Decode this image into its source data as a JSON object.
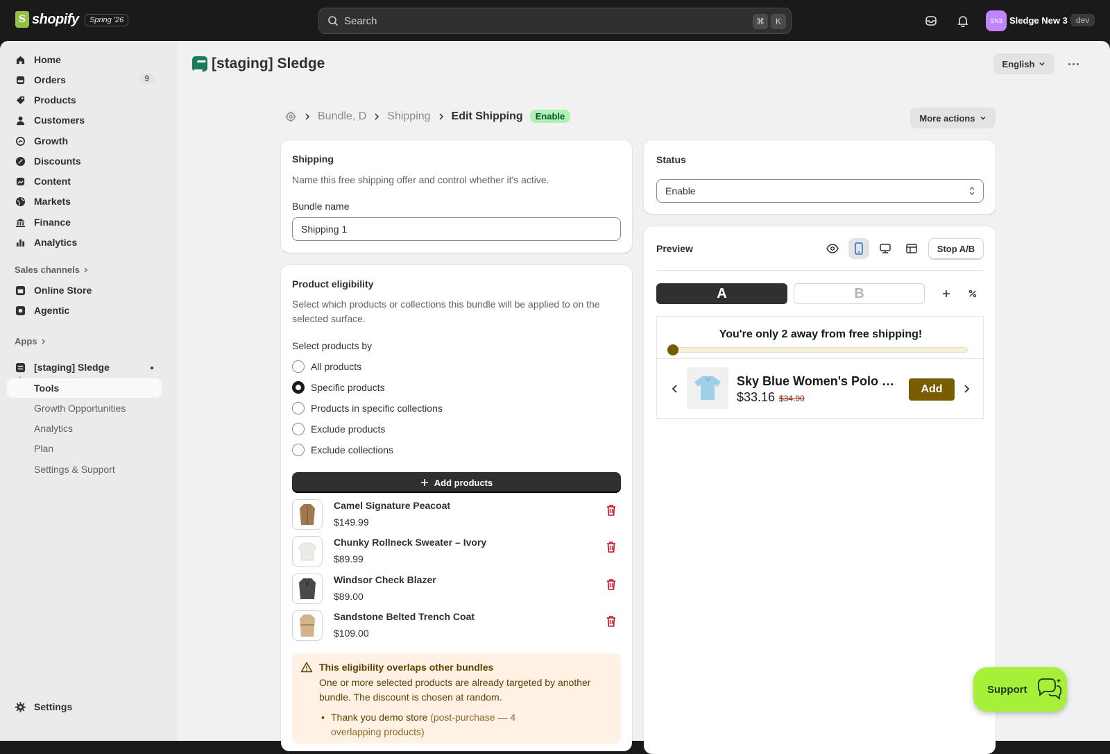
{
  "topbar": {
    "brand": "shopify",
    "edition_badge": "Spring '26",
    "search_placeholder": "Search",
    "shortcut_cmd": "⌘",
    "shortcut_key": "K",
    "avatar_initials": "SN3",
    "store_name": "Sledge New 3",
    "env_badge": "dev"
  },
  "sidebar": {
    "items": [
      {
        "label": "Home",
        "icon": "home-icon"
      },
      {
        "label": "Orders",
        "icon": "orders-icon",
        "count": "9"
      },
      {
        "label": "Products",
        "icon": "tag-icon"
      },
      {
        "label": "Customers",
        "icon": "person-icon"
      },
      {
        "label": "Growth",
        "icon": "growth-icon"
      },
      {
        "label": "Discounts",
        "icon": "discount-icon"
      },
      {
        "label": "Content",
        "icon": "content-icon"
      },
      {
        "label": "Markets",
        "icon": "globe-icon"
      },
      {
        "label": "Finance",
        "icon": "bank-icon"
      },
      {
        "label": "Analytics",
        "icon": "bar-chart-icon"
      }
    ],
    "sales_channels_label": "Sales channels",
    "channels": [
      {
        "label": "Online Store",
        "icon": "store-icon"
      },
      {
        "label": "Agentic",
        "icon": "agentic-icon"
      }
    ],
    "apps_label": "Apps",
    "app": {
      "label": "[staging] Sledge",
      "sub_items": [
        "Tools",
        "Growth Opportunities",
        "Analytics",
        "Plan",
        "Settings & Support"
      ]
    },
    "settings_label": "Settings"
  },
  "header": {
    "app_title": "[staging] Sledge",
    "language": "English"
  },
  "breadcrumbs": {
    "items": [
      "Bundle, D",
      "Shipping"
    ],
    "current": "Edit Shipping",
    "status_badge": "Enable",
    "more_actions": "More actions"
  },
  "shipping_card": {
    "title": "Shipping",
    "description": "Name this free shipping offer and control whether it's active.",
    "name_label": "Bundle name",
    "name_value": "Shipping 1"
  },
  "eligibility_card": {
    "title": "Product eligibility",
    "description": "Select which products or collections this bundle will be applied to on the selected surface.",
    "select_label": "Select products by",
    "options": [
      "All products",
      "Specific products",
      "Products in specific collections",
      "Exclude products",
      "Exclude collections"
    ],
    "selected_option": "Specific products",
    "add_button": "Add products",
    "products": [
      {
        "name": "Camel Signature Peacoat",
        "price": "$149.99",
        "thumb_color": "#a07a4e"
      },
      {
        "name": "Chunky Rollneck Sweater – Ivory",
        "price": "$89.99",
        "thumb_color": "#ecebe6"
      },
      {
        "name": "Windsor Check Blazer",
        "price": "$89.00",
        "thumb_color": "#4a4a4a"
      },
      {
        "name": "Sandstone Belted Trench Coat",
        "price": "$109.00",
        "thumb_color": "#d2b48c"
      }
    ],
    "warning": {
      "title": "This eligibility overlaps other bundles",
      "text": "One or more selected products are already targeted by another bundle. The discount is chosen at random.",
      "item_store": "Thank you demo store",
      "item_detail": "(post-purchase — 4 overlapping products)"
    }
  },
  "status_card": {
    "title": "Status",
    "value": "Enable"
  },
  "preview_card": {
    "title": "Preview",
    "stop_ab": "Stop A/B",
    "tab_a": "A",
    "tab_b": "B",
    "widget": {
      "message": "You're only 2 away from free shipping!",
      "progress_fraction": 0.0,
      "product_title": "Sky Blue Women's Polo S...",
      "price": "$33.16",
      "compare_price": "$34.90",
      "add_label": "Add"
    }
  },
  "support": {
    "label": "Support"
  },
  "colors": {
    "topbar": "#1a1a1a",
    "accent_badge": "#aff0b5",
    "widget_brand": "#7a5c00",
    "support_bg": "#a6f03a"
  }
}
